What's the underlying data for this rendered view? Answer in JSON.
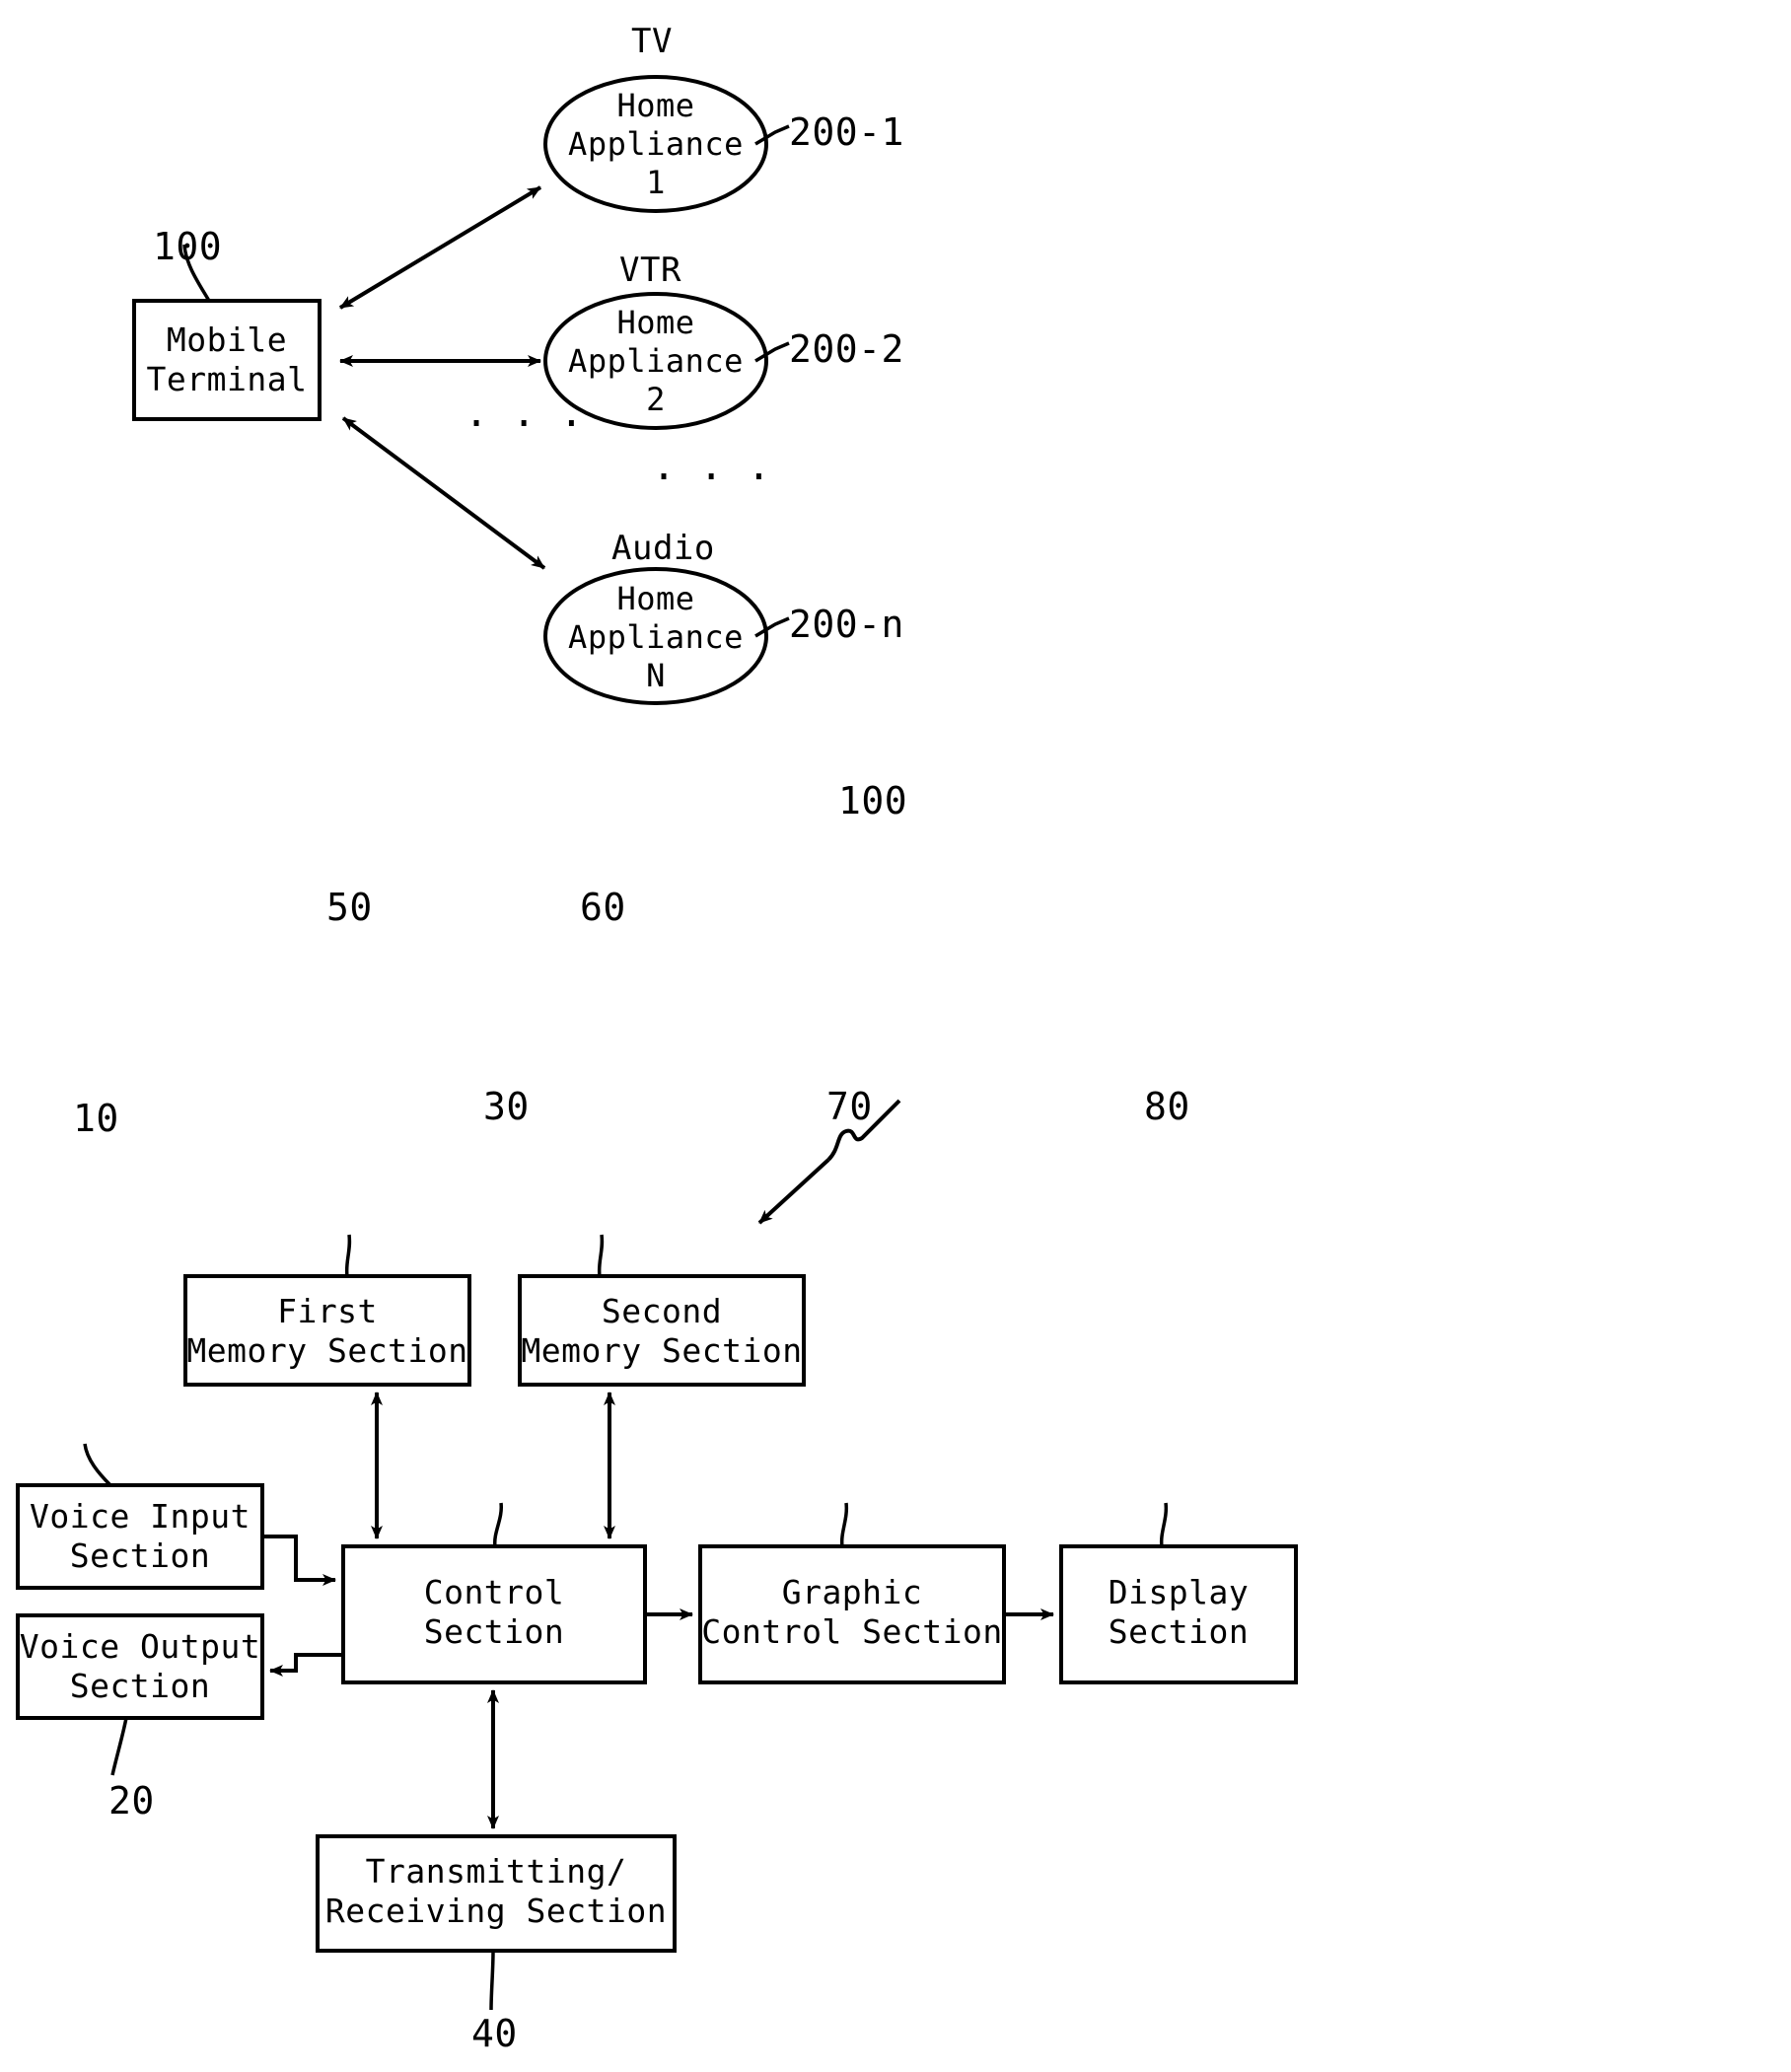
{
  "figure": {
    "title": "Block diagram of mobile terminal controlling home appliances",
    "line_color": "#000000",
    "background_color": "#ffffff"
  },
  "top_diagram": {
    "terminal": {
      "label": "Mobile\nTerminal",
      "ref": "100"
    },
    "appliances": [
      {
        "caption": "TV",
        "label": "Home\nAppliance\n1",
        "ref": "200-1"
      },
      {
        "caption": "VTR",
        "label": "Home\nAppliance\n2",
        "ref": "200-2"
      },
      {
        "caption": "Audio",
        "label": "Home\nAppliance\nN",
        "ref": "200-n"
      }
    ],
    "ellipsis_left": "·\n·\n·",
    "ellipsis_right": "·\n·\n·"
  },
  "bottom_diagram": {
    "system_ref": "100",
    "blocks": [
      {
        "id": "voice-input",
        "label": "Voice Input\nSection",
        "ref": "10"
      },
      {
        "id": "voice-output",
        "label": "Voice Output\nSection",
        "ref": "20"
      },
      {
        "id": "control",
        "label": "Control\nSection",
        "ref": "30"
      },
      {
        "id": "transceiver",
        "label": "Transmitting/\nReceiving Section",
        "ref": "40"
      },
      {
        "id": "first-memory",
        "label": "First\nMemory Section",
        "ref": "50"
      },
      {
        "id": "second-memory",
        "label": "Second\nMemory Section",
        "ref": "60"
      },
      {
        "id": "graphic",
        "label": "Graphic\nControl Section",
        "ref": "70"
      },
      {
        "id": "display",
        "label": "Display\nSection",
        "ref": "80"
      }
    ]
  }
}
